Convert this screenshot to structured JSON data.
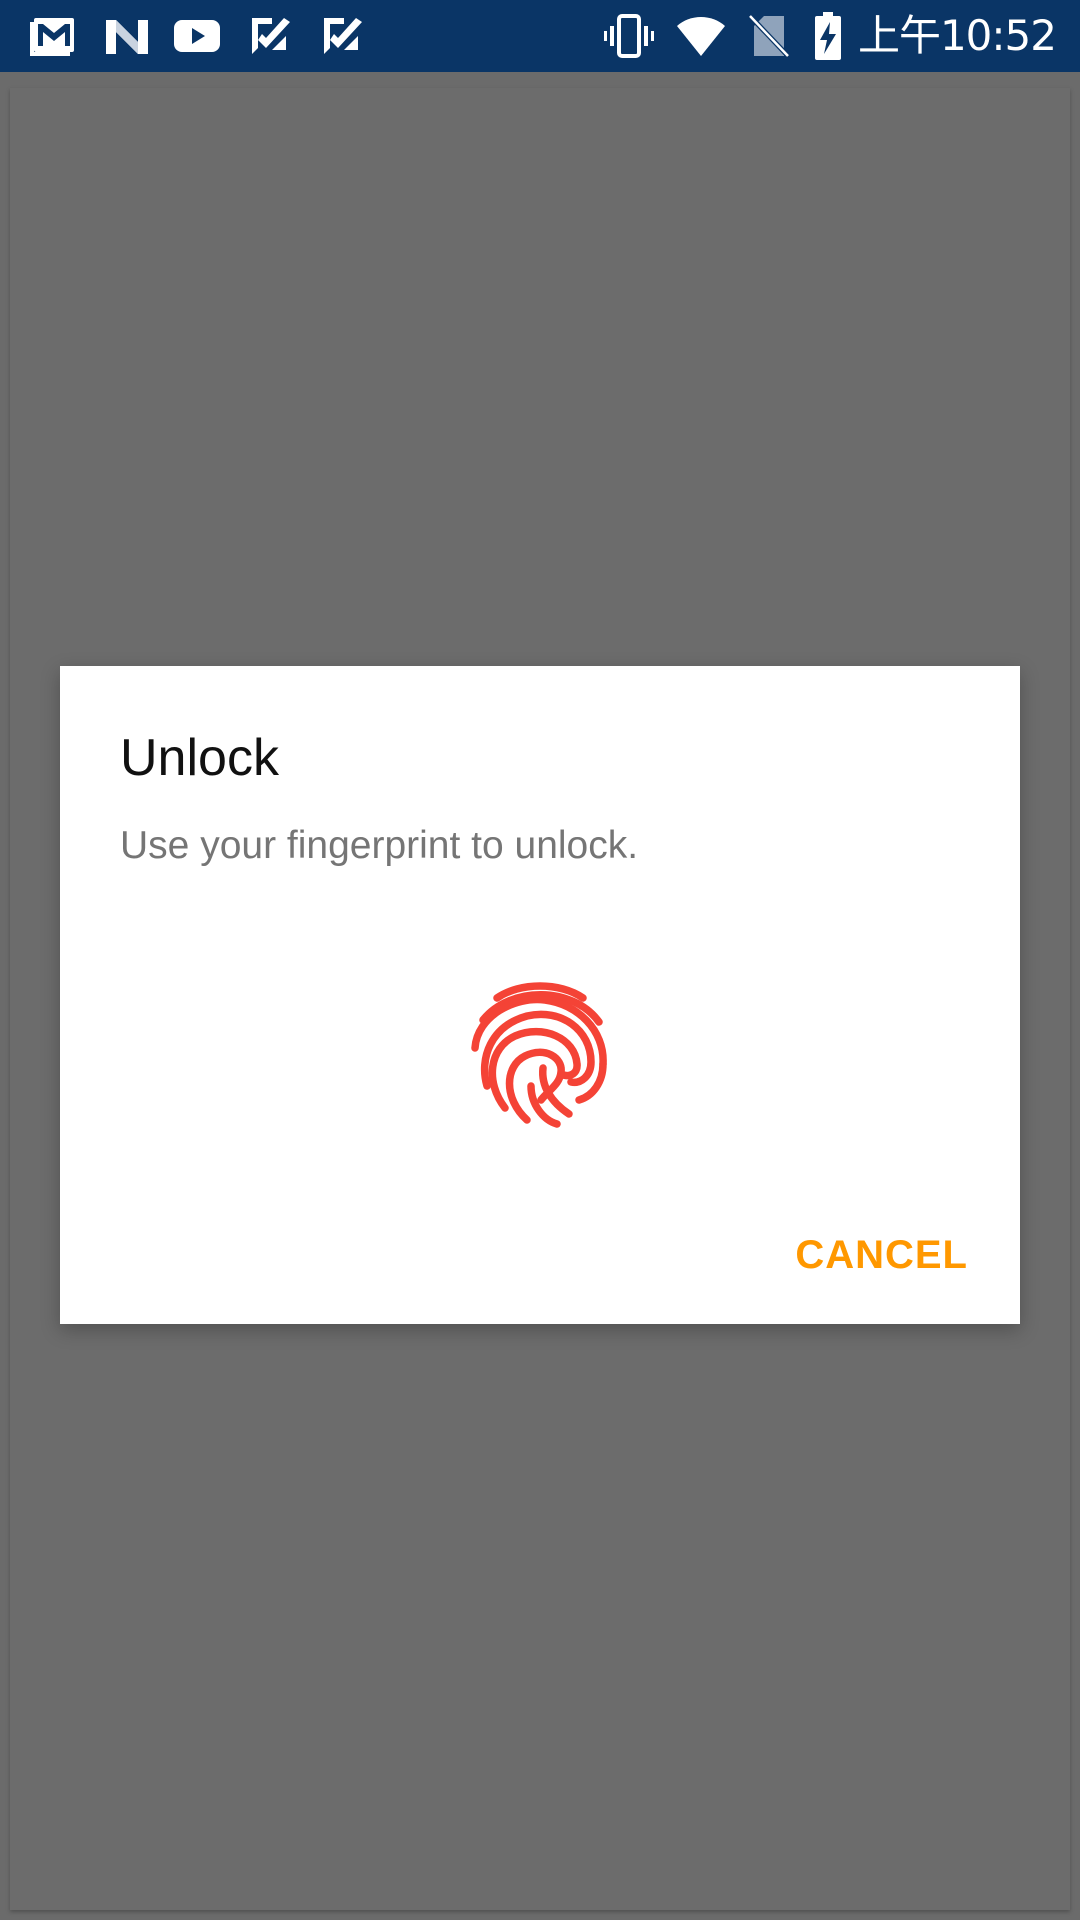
{
  "status_bar": {
    "time": "上午10:52",
    "left_icons": [
      "gmail-icon",
      "n-app-icon",
      "youtube-icon",
      "check-task-icon",
      "check-task-icon"
    ],
    "right_icons": [
      "vibrate-icon",
      "wifi-icon",
      "no-sim-icon",
      "battery-charging-icon"
    ],
    "background_color": "#0a3566"
  },
  "dialog": {
    "title": "Unlock",
    "description": "Use your fingerprint to unlock.",
    "icon": "fingerprint-icon",
    "icon_color": "#f44336",
    "cancel_label": "CANCEL",
    "accent_color": "#ff9800"
  }
}
